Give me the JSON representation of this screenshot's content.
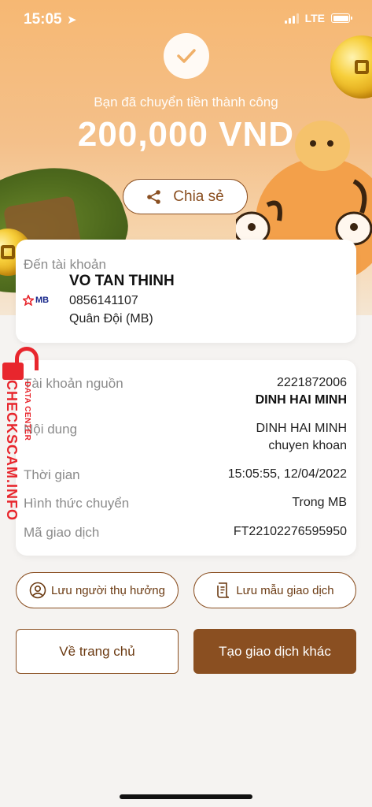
{
  "status_bar": {
    "time": "15:05",
    "network": "LTE"
  },
  "header": {
    "success_message": "Bạn đã chuyển tiền thành công",
    "amount": "200,000 VND",
    "share_label": "Chia sẻ"
  },
  "recipient": {
    "label": "Đến tài khoản",
    "bank_logo_text": "MB",
    "name": "VO TAN THINH",
    "account_number": "0856141107",
    "bank_name": "Quân Đội (MB)"
  },
  "details": {
    "source_account": {
      "label": "Tài khoản nguồn",
      "number": "2221872006",
      "owner": "DINH HAI MINH"
    },
    "content": {
      "label": "Nội dung",
      "line1": "DINH HAI MINH",
      "line2": "chuyen khoan"
    },
    "time": {
      "label": "Thời gian",
      "value": "15:05:55, 12/04/2022"
    },
    "method": {
      "label": "Hình thức chuyển",
      "value": "Trong MB"
    },
    "transaction_id": {
      "label": "Mã giao dịch",
      "value": "FT22102276595950"
    }
  },
  "watermark": {
    "site": "CHECKSCAM.INFO",
    "sub": "DATA CENTER"
  },
  "actions": {
    "save_recipient": "Lưu người thụ hưởng",
    "save_template": "Lưu mẫu giao dịch",
    "go_home": "Về trang chủ",
    "new_transaction": "Tạo giao dịch khác"
  },
  "colors": {
    "brand_brown": "#8a4f21",
    "watermark_red": "#e8262d"
  }
}
